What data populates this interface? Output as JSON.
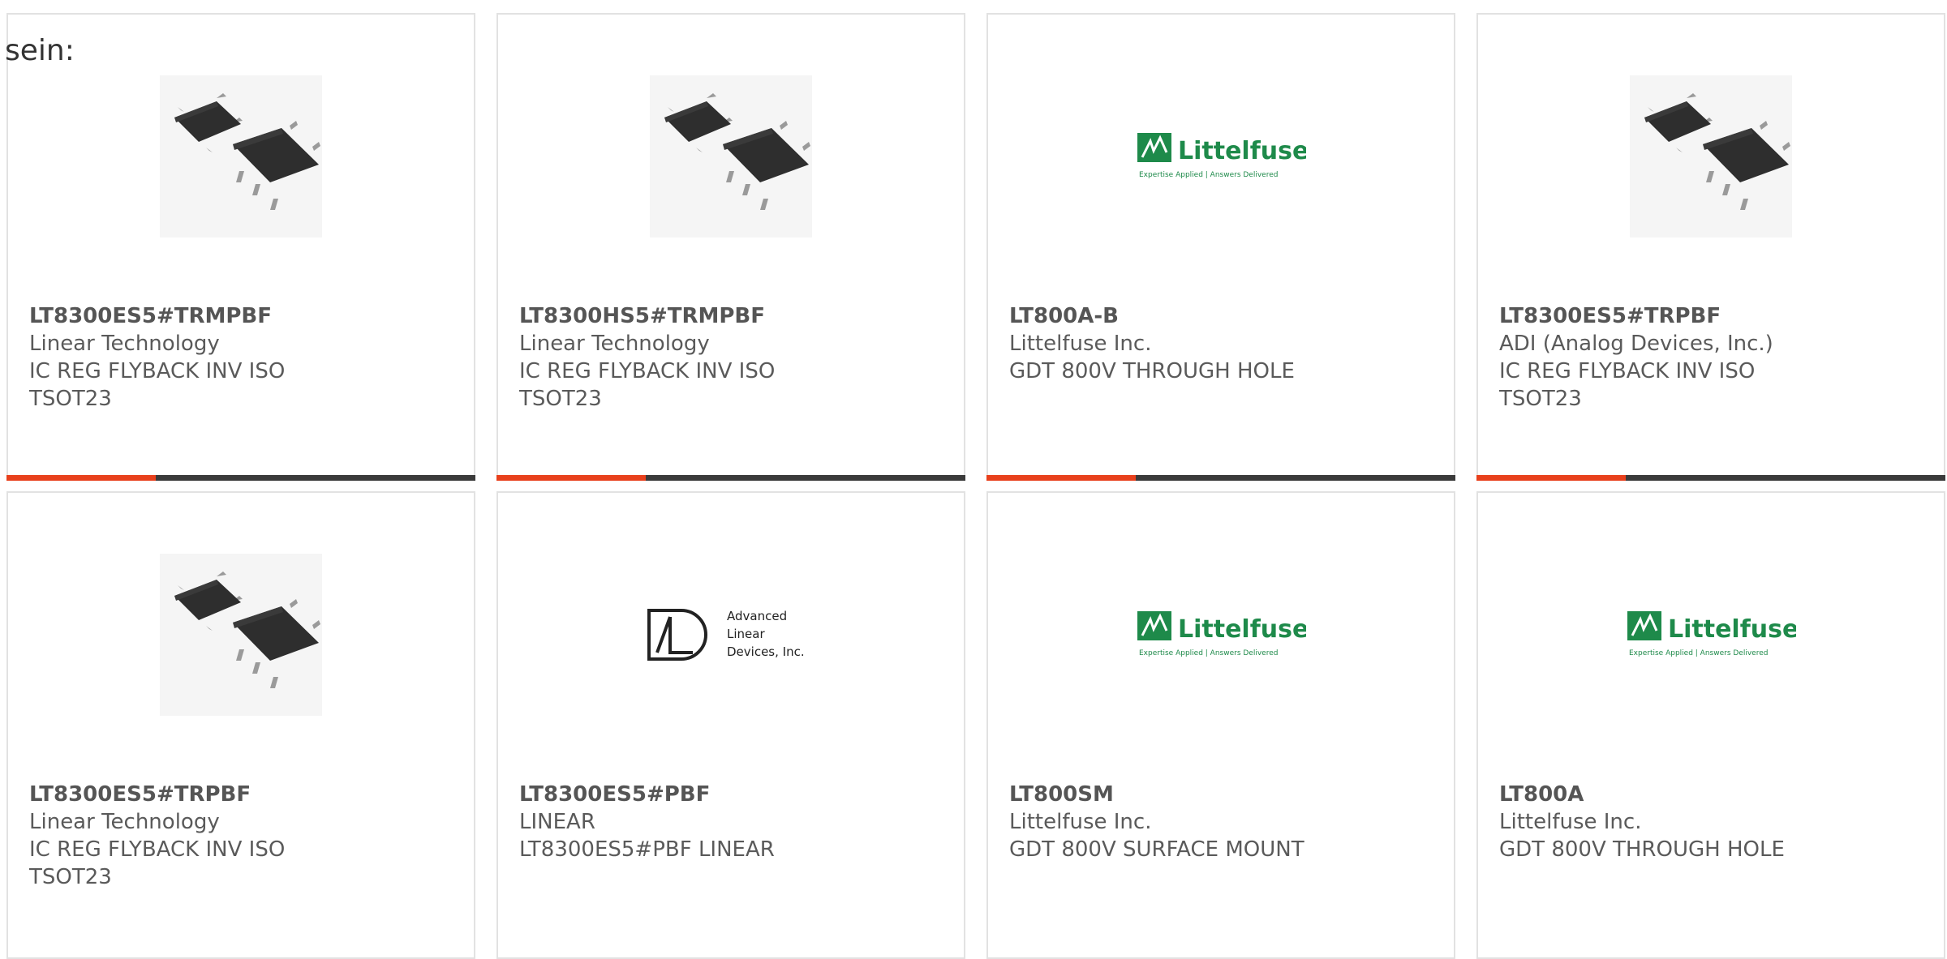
{
  "intro_text": "sein:",
  "cards": [
    {
      "part": "LT8300ES5#TRMPBF",
      "lines": [
        "Linear Technology",
        "IC REG FLYBACK INV ISO",
        "TSOT23"
      ],
      "image": "chip-photo"
    },
    {
      "part": "LT8300HS5#TRMPBF",
      "lines": [
        "Linear Technology",
        "IC REG FLYBACK INV ISO",
        "TSOT23"
      ],
      "image": "chip-photo"
    },
    {
      "part": "LT800A-B",
      "lines": [
        "Littelfuse Inc.",
        "GDT 800V THROUGH HOLE"
      ],
      "image": "littelfuse-logo"
    },
    {
      "part": "LT8300ES5#TRPBF",
      "lines": [
        "ADI (Analog Devices, Inc.)",
        "IC REG FLYBACK INV ISO",
        "TSOT23"
      ],
      "image": "chip-photo"
    },
    {
      "part": "LT8300ES5#TRPBF",
      "lines": [
        "Linear Technology",
        "IC REG FLYBACK INV ISO",
        "TSOT23"
      ],
      "image": "chip-photo"
    },
    {
      "part": "LT8300ES5#PBF",
      "lines": [
        "LINEAR",
        "LT8300ES5#PBF LINEAR"
      ],
      "image": "advanced-linear-logo"
    },
    {
      "part": "LT800SM",
      "lines": [
        "Littelfuse Inc.",
        "GDT 800V SURFACE MOUNT"
      ],
      "image": "littelfuse-logo"
    },
    {
      "part": "LT800A",
      "lines": [
        "Littelfuse Inc.",
        "GDT 800V THROUGH HOLE"
      ],
      "image": "littelfuse-logo"
    }
  ],
  "logos": {
    "littelfuse_name": "Littelfuse",
    "littelfuse_tagline": "Expertise Applied | Answers Delivered",
    "advanced_linear_lines": [
      "Advanced",
      "Linear",
      "Devices, Inc."
    ]
  },
  "colors": {
    "accent": "#e8401c",
    "bar": "#3a3a3a",
    "littelfuse_green": "#1e8a4a"
  }
}
